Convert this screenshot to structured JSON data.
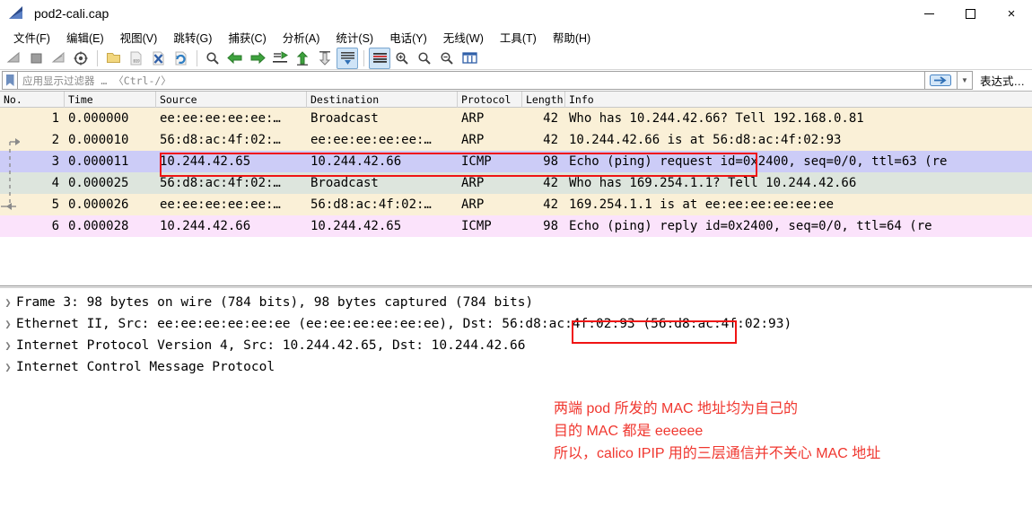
{
  "window": {
    "title": "pod2-cali.cap",
    "logo_icon": "wireshark-fin-logo",
    "minimize_label": "",
    "maximize_label": "",
    "close_label": "×"
  },
  "menu": {
    "items": [
      {
        "label": "文件(F)",
        "name": "menu-file"
      },
      {
        "label": "编辑(E)",
        "name": "menu-edit"
      },
      {
        "label": "视图(V)",
        "name": "menu-view"
      },
      {
        "label": "跳转(G)",
        "name": "menu-go"
      },
      {
        "label": "捕获(C)",
        "name": "menu-capture"
      },
      {
        "label": "分析(A)",
        "name": "menu-analyze"
      },
      {
        "label": "统计(S)",
        "name": "menu-statistics"
      },
      {
        "label": "电话(Y)",
        "name": "menu-telephony"
      },
      {
        "label": "无线(W)",
        "name": "menu-wireless"
      },
      {
        "label": "工具(T)",
        "name": "menu-tools"
      },
      {
        "label": "帮助(H)",
        "name": "menu-help"
      }
    ]
  },
  "toolbar": {
    "buttons": [
      {
        "icon": "start-capture-icon",
        "active": false
      },
      {
        "icon": "stop-capture-icon",
        "active": false
      },
      {
        "icon": "restart-capture-icon",
        "active": false
      },
      {
        "icon": "capture-options-icon",
        "active": false
      },
      {
        "sep": true
      },
      {
        "icon": "open-file-icon",
        "active": false
      },
      {
        "icon": "save-file-icon",
        "active": false
      },
      {
        "icon": "close-file-icon",
        "active": false
      },
      {
        "icon": "reload-file-icon",
        "active": false
      },
      {
        "sep": true
      },
      {
        "icon": "find-packet-icon",
        "active": false
      },
      {
        "icon": "go-back-icon",
        "active": false
      },
      {
        "icon": "go-forward-icon",
        "active": false
      },
      {
        "icon": "go-to-packet-icon",
        "active": false
      },
      {
        "icon": "go-first-packet-icon",
        "active": false
      },
      {
        "icon": "go-last-packet-icon",
        "active": false
      },
      {
        "icon": "auto-scroll-icon",
        "active": true
      },
      {
        "sep": true
      },
      {
        "icon": "colorize-packets-icon",
        "active": true
      },
      {
        "icon": "zoom-in-icon",
        "active": false
      },
      {
        "icon": "zoom-out-icon",
        "active": false
      },
      {
        "icon": "zoom-reset-icon",
        "active": false
      },
      {
        "icon": "resize-columns-icon",
        "active": false
      }
    ]
  },
  "filter": {
    "bookmark_icon": "filter-bookmark-icon",
    "placeholder": "应用显示过滤器 … 〈Ctrl-/〉",
    "value": "",
    "apply_icon": "apply-filter-arrow-icon",
    "dropdown_icon": "chevron-down-icon",
    "expression_label": "表达式…"
  },
  "packet_list": {
    "columns": [
      "No.",
      "Time",
      "Source",
      "Destination",
      "Protocol",
      "Length",
      "Info"
    ],
    "rows": [
      {
        "no": "1",
        "time": "0.000000",
        "source": "ee:ee:ee:ee:ee:…",
        "destination": "Broadcast",
        "protocol": "ARP",
        "length": "42",
        "info": "Who has 10.244.42.66? Tell 192.168.0.81",
        "bg": "#faf0d7",
        "selected": false
      },
      {
        "no": "2",
        "time": "0.000010",
        "source": "56:d8:ac:4f:02:…",
        "destination": "ee:ee:ee:ee:ee:…",
        "protocol": "ARP",
        "length": "42",
        "info": "10.244.42.66 is at 56:d8:ac:4f:02:93",
        "bg": "#faf0d7",
        "selected": false
      },
      {
        "no": "3",
        "time": "0.000011",
        "source": "10.244.42.65",
        "destination": "10.244.42.66",
        "protocol": "ICMP",
        "length": "98",
        "info": "Echo (ping) request  id=0x2400, seq=0/0, ttl=63 (re",
        "bg": "#ccccf7",
        "selected": true
      },
      {
        "no": "4",
        "time": "0.000025",
        "source": "56:d8:ac:4f:02:…",
        "destination": "Broadcast",
        "protocol": "ARP",
        "length": "42",
        "info": "Who has 169.254.1.1? Tell 10.244.42.66",
        "bg": "#dde5dd",
        "selected": false
      },
      {
        "no": "5",
        "time": "0.000026",
        "source": "ee:ee:ee:ee:ee:…",
        "destination": "56:d8:ac:4f:02:…",
        "protocol": "ARP",
        "length": "42",
        "info": "169.254.1.1 is at ee:ee:ee:ee:ee:ee",
        "bg": "#faf0d7",
        "selected": false
      },
      {
        "no": "6",
        "time": "0.000028",
        "source": "10.244.42.66",
        "destination": "10.244.42.65",
        "protocol": "ICMP",
        "length": "98",
        "info": "Echo (ping) reply    id=0x2400, seq=0/0, ttl=64 (re",
        "bg": "#fbe3fb",
        "selected": false
      }
    ]
  },
  "detail_pane": {
    "caret_icon": "expand-chevron-right-icon",
    "rows": [
      {
        "text": "Frame 3: 98 bytes on wire (784 bits), 98 bytes captured (784 bits)",
        "name": "detail-row-frame"
      },
      {
        "text": "Ethernet II, Src: ee:ee:ee:ee:ee:ee (ee:ee:ee:ee:ee:ee), Dst: 56:d8:ac:4f:02:93 (56:d8:ac:4f:02:93)",
        "name": "detail-row-ethernet"
      },
      {
        "text": "Internet Protocol Version 4, Src: 10.244.42.65, Dst: 10.244.42.66",
        "name": "detail-row-ipv4"
      },
      {
        "text": "Internet Control Message Protocol",
        "name": "detail-row-icmp"
      }
    ]
  },
  "annotations": {
    "color": "#f0372f",
    "lines": [
      "两端 pod 所发的 MAC 地址均为自己的",
      "目的 MAC 都是 eeeeee",
      "所以，calico IPIP 用的三层通信并不关心 MAC 地址"
    ],
    "highlight_boxes": [
      {
        "name": "packet-row-3-highlight-box"
      },
      {
        "name": "ethernet-dst-mac-highlight-box"
      }
    ]
  },
  "colors": {
    "selected_row": "#ccccf7",
    "arp_row": "#faf0d7",
    "green_row": "#dde5dd",
    "icmp_reply_row": "#fbe3fb",
    "annotation_red": "#f0372f",
    "accent_blue": "#2f6fb5"
  }
}
